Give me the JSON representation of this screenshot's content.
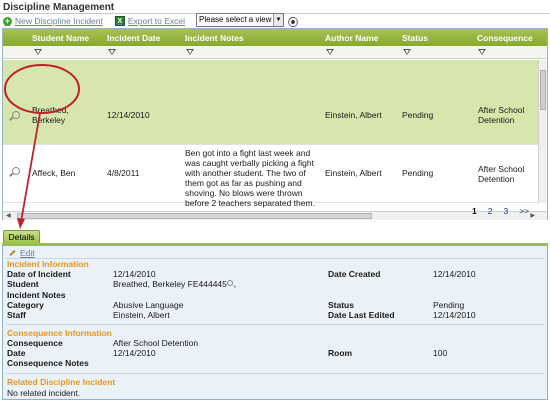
{
  "page": {
    "title": "Discipline Management"
  },
  "toolbar": {
    "new_label": "New Discipline Incident",
    "export_label": "Export to Excel",
    "view_select_value": "Please select a view"
  },
  "grid": {
    "columns": [
      "Student Name",
      "Incident Date",
      "Incident Notes",
      "Author Name",
      "Status",
      "Consequence"
    ],
    "rows": [
      {
        "student_line1": "Breathed,",
        "student_line2": "Berkeley",
        "date": "12/14/2010",
        "notes": "",
        "author": "Einstein, Albert",
        "status": "Pending",
        "consequence_line1": "After School",
        "consequence_line2": "Detention"
      },
      {
        "student_line1": "Affeck, Ben",
        "student_line2": "",
        "date": "4/8/2011",
        "notes_lines": [
          "Ben got into a fight last week and",
          "was caught verbally picking a fight",
          "with another student. The two of",
          "them got as far as pushing and",
          "shoving. No blows were thrown",
          "before 2 teachers separated them."
        ],
        "author": "Einstein, Albert",
        "status": "Pending",
        "consequence_line1": "After School",
        "consequence_line2": "Detention"
      }
    ],
    "pager": [
      "1",
      "2",
      "3",
      ">>"
    ]
  },
  "details": {
    "tab_label": "Details",
    "edit_label": "Edit",
    "incident_section": "Incident Information",
    "fields": {
      "date_of_incident_label": "Date of Incident",
      "date_of_incident": "12/14/2010",
      "date_created_label": "Date Created",
      "date_created": "12/14/2010",
      "student_label": "Student",
      "student": "Breathed, Berkeley FE444445",
      "incident_notes_label": "Incident Notes",
      "category_label": "Category",
      "category": "Abusive Language",
      "status_label": "Status",
      "status": "Pending",
      "staff_label": "Staff",
      "staff": "Einstein, Albert",
      "date_last_edited_label": "Date Last Edited",
      "date_last_edited": "12/14/2010"
    },
    "consequence_section": "Consequence Information",
    "consequence": {
      "consequence_label": "Consequence",
      "consequence": "After School Detention",
      "date_label": "Date",
      "date": "12/14/2010",
      "room_label": "Room",
      "room": "100",
      "notes_label": "Consequence Notes"
    },
    "related_section": "Related Discipline Incident",
    "related_text": "No related incident."
  },
  "colors": {
    "header_green": "#8fb03a",
    "selected_row": "#d6e6ad",
    "section_orange": "#e8961f",
    "annotation_red": "#c0202a",
    "panel_bg": "#eaf2f8"
  }
}
